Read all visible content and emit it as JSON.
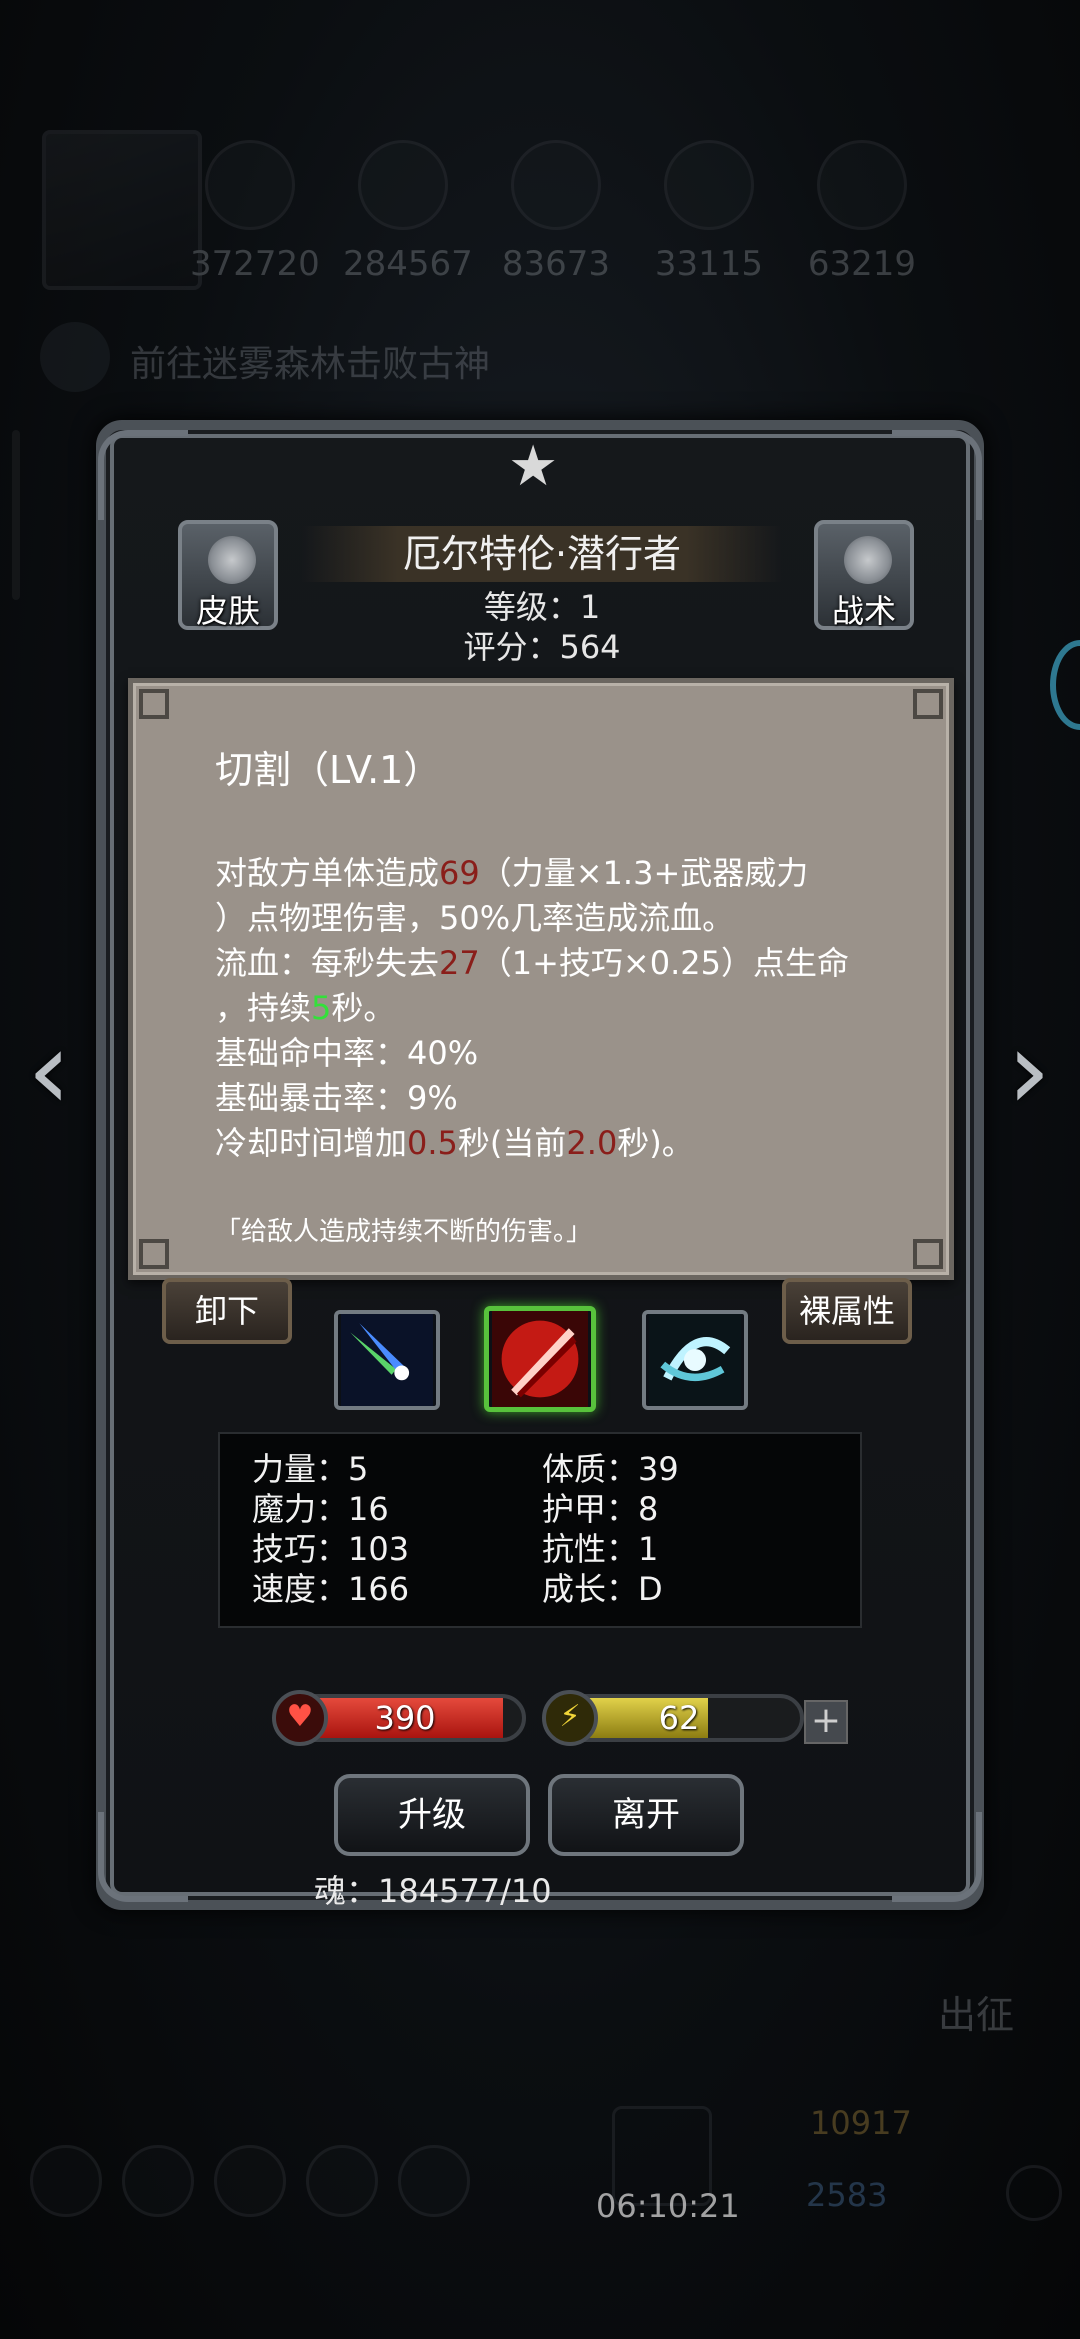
{
  "background": {
    "resources": [
      "372720",
      "284567",
      "83673",
      "33115",
      "63219"
    ],
    "goto_text": "前往迷雾森林击败古神",
    "march_label": "出征",
    "timer": "06:10:21",
    "gold": "10917",
    "gems": "2583"
  },
  "hero": {
    "name": "厄尔特伦·潜行者",
    "level": "等级：1",
    "score": "评分：564",
    "skin_label": "皮肤",
    "tactic_label": "战术"
  },
  "skill": {
    "title": "切割（LV.1）",
    "desc": {
      "l1_a": "对敌方单体造成",
      "l1_dmg": "69",
      "l1_b": "（力量×1.3+武器威力",
      "l2": "）点物理伤害，50%几率造成流血。",
      "l3_a": "流血：每秒失去",
      "l3_val": "27",
      "l3_b": "（1+技巧×0.25）点生命",
      "l4_a": "，持续",
      "l4_val": "5",
      "l4_b": "秒。",
      "l5": "基础命中率：40%",
      "l6": "基础暴击率：9%",
      "l7_a": "冷却时间增加",
      "l7_val": "0.5",
      "l7_b": "秒(当前",
      "l7_cur": "2.0",
      "l7_c": "秒)。"
    },
    "flavor": "「给敌人造成持续不断的伤害。」"
  },
  "buttons": {
    "unequip": "卸下",
    "naked_attr": "裸属性",
    "upgrade": "升级",
    "leave": "离开"
  },
  "stats": {
    "str": "力量：5",
    "con": "体质：39",
    "mag": "魔力：16",
    "armor": "护甲：8",
    "skill": "技巧：103",
    "res": "抗性：1",
    "spd": "速度：166",
    "growth": "成长：D"
  },
  "bars": {
    "hp": "390",
    "hp_fill": 0.92,
    "energy": "62",
    "energy_fill": 0.62
  },
  "soul": "魂：184577/10",
  "colors": {
    "damage": "#8a1e1a",
    "duration": "#33e03a",
    "tooltip_bg": "#9a928a",
    "selected_slot": "#58c23c"
  }
}
